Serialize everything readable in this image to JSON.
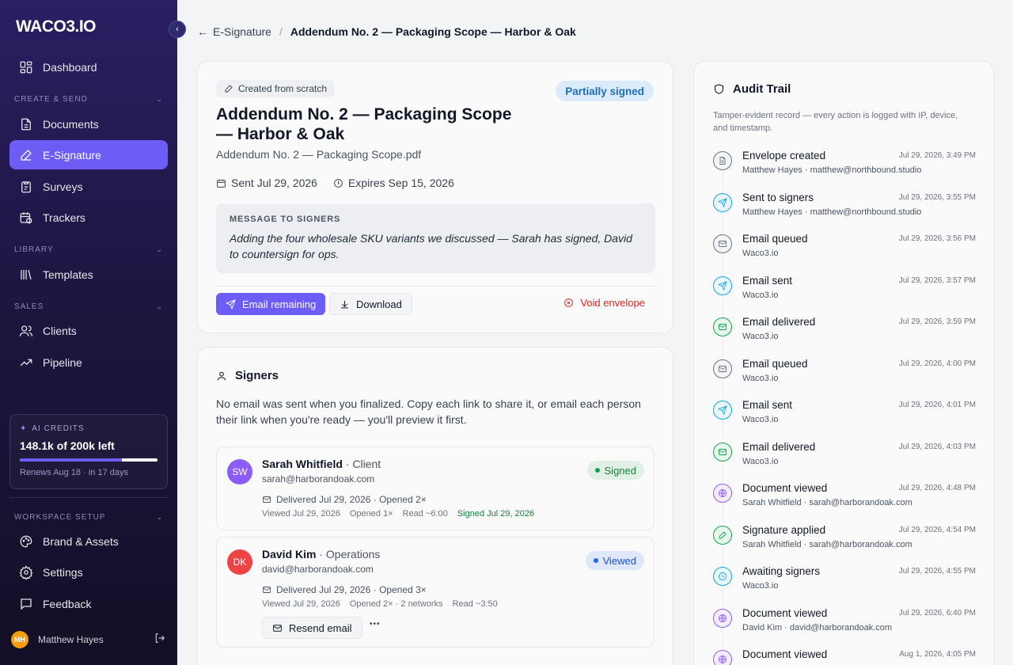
{
  "app": {
    "logo": "WACO3.IO",
    "accent": "#6d5cf5"
  },
  "sidebar": {
    "dashboard": "Dashboard",
    "section_create": "CREATE & SEND",
    "documents": "Documents",
    "esignature": "E-Signature",
    "surveys": "Surveys",
    "trackers": "Trackers",
    "section_library": "LIBRARY",
    "templates": "Templates",
    "section_sales": "SALES",
    "clients": "Clients",
    "pipeline": "Pipeline",
    "credits": {
      "label": "AI CREDITS",
      "amount": "148.1k of 200k left",
      "used_fraction": 0.74,
      "renews": "Renews Aug 18 · in 17 days"
    },
    "section_workspace": "WORKSPACE SETUP",
    "brand": "Brand & Assets",
    "settings": "Settings",
    "feedback": "Feedback",
    "user": {
      "initials": "MH",
      "name": "Matthew Hayes"
    }
  },
  "breadcrumb": {
    "parent": "E-Signature",
    "current": "Addendum No. 2 — Packaging Scope — Harbor & Oak"
  },
  "envelope": {
    "created_pill": "Created from scratch",
    "status": "Partially signed",
    "title": "Addendum No. 2 — Packaging Scope — Harbor & Oak",
    "file": "Addendum No. 2 — Packaging Scope.pdf",
    "sent": "Sent Jul 29, 2026",
    "expires": "Expires Sep 15, 2026",
    "message_header": "MESSAGE TO SIGNERS",
    "message": "Adding the four wholesale SKU variants we discussed — Sarah has signed, David to countersign for ops.",
    "email_remaining": "Email remaining",
    "download": "Download",
    "void": "Void envelope"
  },
  "signers": {
    "heading": "Signers",
    "description": "No email was sent when you finalized. Copy each link to share it, or email each person their link when you're ready — you'll preview it first.",
    "list": [
      {
        "initials": "SW",
        "name": "Sarah Whitfield",
        "role": " · Client",
        "email": "sarah@harborandoak.com",
        "delivered": "Delivered Jul 29, 2026 · Opened 2×",
        "viewed": "Viewed Jul 29, 2026",
        "opened": "Opened 1×",
        "read": "Read ~6:00",
        "signed": "Signed Jul 29, 2026",
        "status": "Signed",
        "color": "#8b5cf6"
      },
      {
        "initials": "DK",
        "name": "David Kim",
        "role": " · Operations",
        "email": "david@harborandoak.com",
        "delivered": "Delivered Jul 29, 2026 · Opened 3×",
        "viewed": "Viewed Jul 29, 2026",
        "opened": "Opened 2× · 2 networks",
        "read": "Read ~3:50",
        "status": "Viewed",
        "resend": "Resend email",
        "more": "•••",
        "color": "#ef4444"
      }
    ]
  },
  "audit": {
    "heading": "Audit Trail",
    "description": "Tamper-evident record — every action is logged with IP, device, and timestamp.",
    "events": [
      {
        "title": "Envelope created",
        "sub": "Matthew Hayes · matthew@northbound.studio",
        "time": "Jul 29, 2026, 3:49 PM",
        "icon": "document-icon"
      },
      {
        "title": "Sent to signers",
        "sub": "Matthew Hayes · matthew@northbound.studio",
        "time": "Jul 29, 2026, 3:55 PM",
        "icon": "send-icon"
      },
      {
        "title": "Email queued",
        "sub": "Waco3.io",
        "time": "Jul 29, 2026, 3:56 PM",
        "icon": "mail-icon"
      },
      {
        "title": "Email sent",
        "sub": "Waco3.io",
        "time": "Jul 29, 2026, 3:57 PM",
        "icon": "send-icon"
      },
      {
        "title": "Email delivered",
        "sub": "Waco3.io",
        "time": "Jul 29, 2026, 3:59 PM",
        "icon": "mail-check-icon"
      },
      {
        "title": "Email queued",
        "sub": "Waco3.io",
        "time": "Jul 29, 2026, 4:00 PM",
        "icon": "mail-icon"
      },
      {
        "title": "Email sent",
        "sub": "Waco3.io",
        "time": "Jul 29, 2026, 4:01 PM",
        "icon": "send-icon"
      },
      {
        "title": "Email delivered",
        "sub": "Waco3.io",
        "time": "Jul 29, 2026, 4:03 PM",
        "icon": "mail-check-icon"
      },
      {
        "title": "Document viewed",
        "sub": "Sarah Whitfield · sarah@harborandoak.com",
        "time": "Jul 29, 2026, 4:48 PM",
        "icon": "globe-icon"
      },
      {
        "title": "Signature applied",
        "sub": "Sarah Whitfield · sarah@harborandoak.com",
        "time": "Jul 29, 2026, 4:54 PM",
        "icon": "pen-icon"
      },
      {
        "title": "Awaiting signers",
        "sub": "Waco3.io",
        "time": "Jul 29, 2026, 4:55 PM",
        "icon": "clock-icon"
      },
      {
        "title": "Document viewed",
        "sub": "David Kim · david@harborandoak.com",
        "time": "Jul 29, 2026, 6:40 PM",
        "icon": "globe-icon"
      },
      {
        "title": "Document viewed",
        "sub": "",
        "time": "Aug 1, 2026, 4:05 PM",
        "icon": "globe-icon"
      }
    ]
  }
}
